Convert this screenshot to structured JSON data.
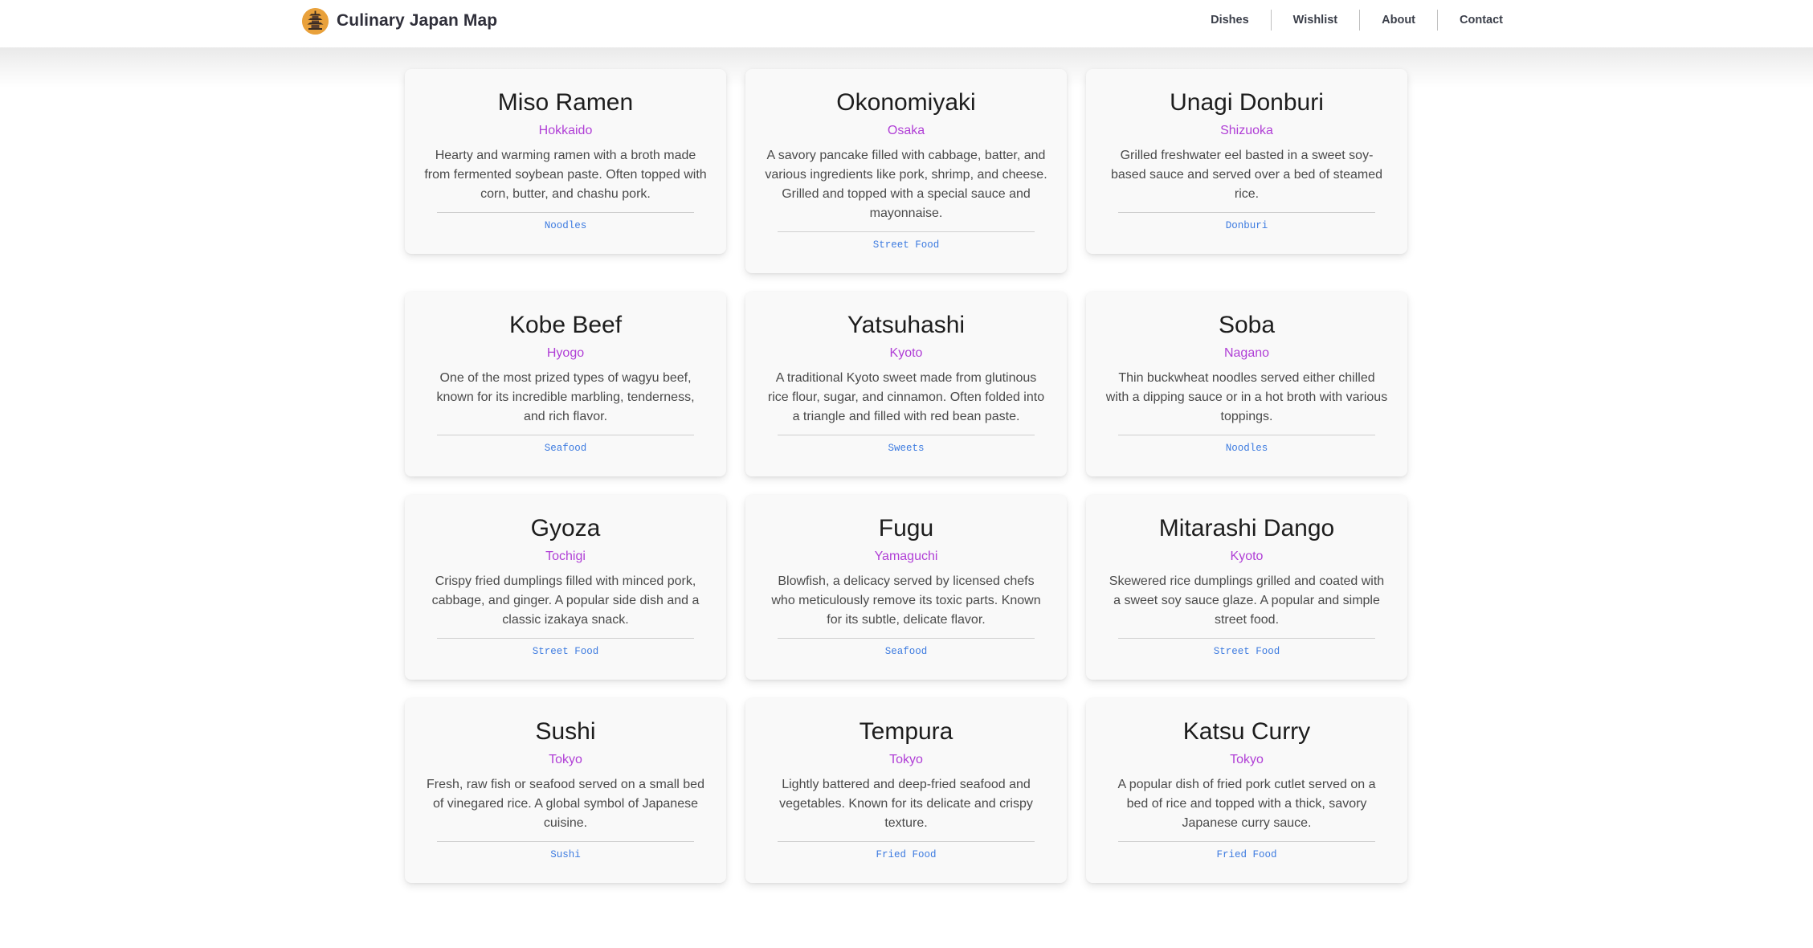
{
  "header": {
    "title": "Culinary Japan Map",
    "logo_icon": "pagoda-icon",
    "nav": [
      "Dishes",
      "Wishlist",
      "About",
      "Contact"
    ]
  },
  "colors": {
    "region": "#b03fd6",
    "tag": "#3d7be0",
    "logo": "#e9a13b"
  },
  "dishes": [
    {
      "name": "Miso Ramen",
      "region": "Hokkaido",
      "description": "Hearty and warming ramen with a broth made from fermented soybean paste. Often topped with corn, butter, and chashu pork.",
      "tag": "Noodles"
    },
    {
      "name": "Okonomiyaki",
      "region": "Osaka",
      "description": "A savory pancake filled with cabbage, batter, and various ingredients like pork, shrimp, and cheese. Grilled and topped with a special sauce and mayonnaise.",
      "tag": "Street Food"
    },
    {
      "name": "Unagi Donburi",
      "region": "Shizuoka",
      "description": "Grilled freshwater eel basted in a sweet soy-based sauce and served over a bed of steamed rice.",
      "tag": "Donburi"
    },
    {
      "name": "Kobe Beef",
      "region": "Hyogo",
      "description": "One of the most prized types of wagyu beef, known for its incredible marbling, tenderness, and rich flavor.",
      "tag": "Seafood"
    },
    {
      "name": "Yatsuhashi",
      "region": "Kyoto",
      "description": "A traditional Kyoto sweet made from glutinous rice flour, sugar, and cinnamon. Often folded into a triangle and filled with red bean paste.",
      "tag": "Sweets"
    },
    {
      "name": "Soba",
      "region": "Nagano",
      "description": "Thin buckwheat noodles served either chilled with a dipping sauce or in a hot broth with various toppings.",
      "tag": "Noodles"
    },
    {
      "name": "Gyoza",
      "region": "Tochigi",
      "description": "Crispy fried dumplings filled with minced pork, cabbage, and ginger. A popular side dish and a classic izakaya snack.",
      "tag": "Street Food"
    },
    {
      "name": "Fugu",
      "region": "Yamaguchi",
      "description": "Blowfish, a delicacy served by licensed chefs who meticulously remove its toxic parts. Known for its subtle, delicate flavor.",
      "tag": "Seafood"
    },
    {
      "name": "Mitarashi Dango",
      "region": "Kyoto",
      "description": "Skewered rice dumplings grilled and coated with a sweet soy sauce glaze. A popular and simple street food.",
      "tag": "Street Food"
    },
    {
      "name": "Sushi",
      "region": "Tokyo",
      "description": "Fresh, raw fish or seafood served on a small bed of vinegared rice. A global symbol of Japanese cuisine.",
      "tag": "Sushi"
    },
    {
      "name": "Tempura",
      "region": "Tokyo",
      "description": "Lightly battered and deep-fried seafood and vegetables. Known for its delicate and crispy texture.",
      "tag": "Fried Food"
    },
    {
      "name": "Katsu Curry",
      "region": "Tokyo",
      "description": "A popular dish of fried pork cutlet served on a bed of rice and topped with a thick, savory Japanese curry sauce.",
      "tag": "Fried Food"
    }
  ]
}
